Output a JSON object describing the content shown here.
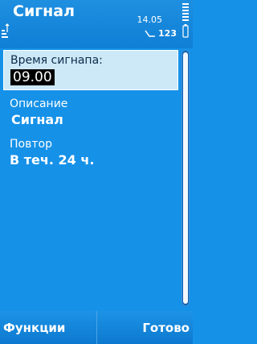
{
  "status_bar": {
    "title": "Сигнал",
    "time": "14.05",
    "input_mode": "123"
  },
  "form": {
    "alarm_time": {
      "label": "Время сигнапа:",
      "value": "09.00"
    },
    "description": {
      "label": "Описание",
      "value": "Сигнал"
    },
    "repeat": {
      "label": "Повтор",
      "value": "В теч. 24 ч."
    }
  },
  "softkeys": {
    "left": "Функции",
    "right": "Готово"
  },
  "colors": {
    "background": "#1591e8",
    "selected_field": "#cde9f8"
  }
}
